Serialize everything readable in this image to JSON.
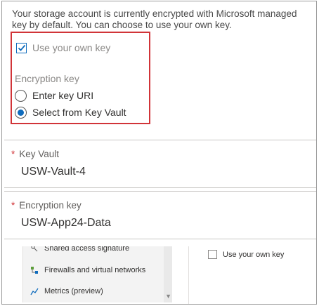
{
  "intro_text": "Your storage account is currently encrypted with Microsoft managed key by default. You can choose to use your own key.",
  "use_own_key": {
    "label": "Use your own key",
    "checked": true
  },
  "encryption_key_group": {
    "label": "Encryption key",
    "options": [
      {
        "label": "Enter key URI",
        "selected": false
      },
      {
        "label": "Select from Key Vault",
        "selected": true
      }
    ]
  },
  "key_vault_field": {
    "label": "Key Vault",
    "value": "USW-Vault-4",
    "required_mark": "*"
  },
  "encryption_key_field": {
    "label": "Encryption key",
    "value": "USW-App24-Data",
    "required_mark": "*"
  },
  "background_panel": {
    "nav_items": [
      {
        "label": "Shared access signature",
        "icon": "key-icon"
      },
      {
        "label": "Firewalls and virtual networks",
        "icon": "network-icon"
      },
      {
        "label": "Metrics (preview)",
        "icon": "metrics-icon"
      }
    ],
    "checkbox_label": "Use your own key"
  },
  "colors": {
    "accent": "#0f6cbd",
    "highlight_border": "#d13438",
    "required": "#d13438"
  }
}
